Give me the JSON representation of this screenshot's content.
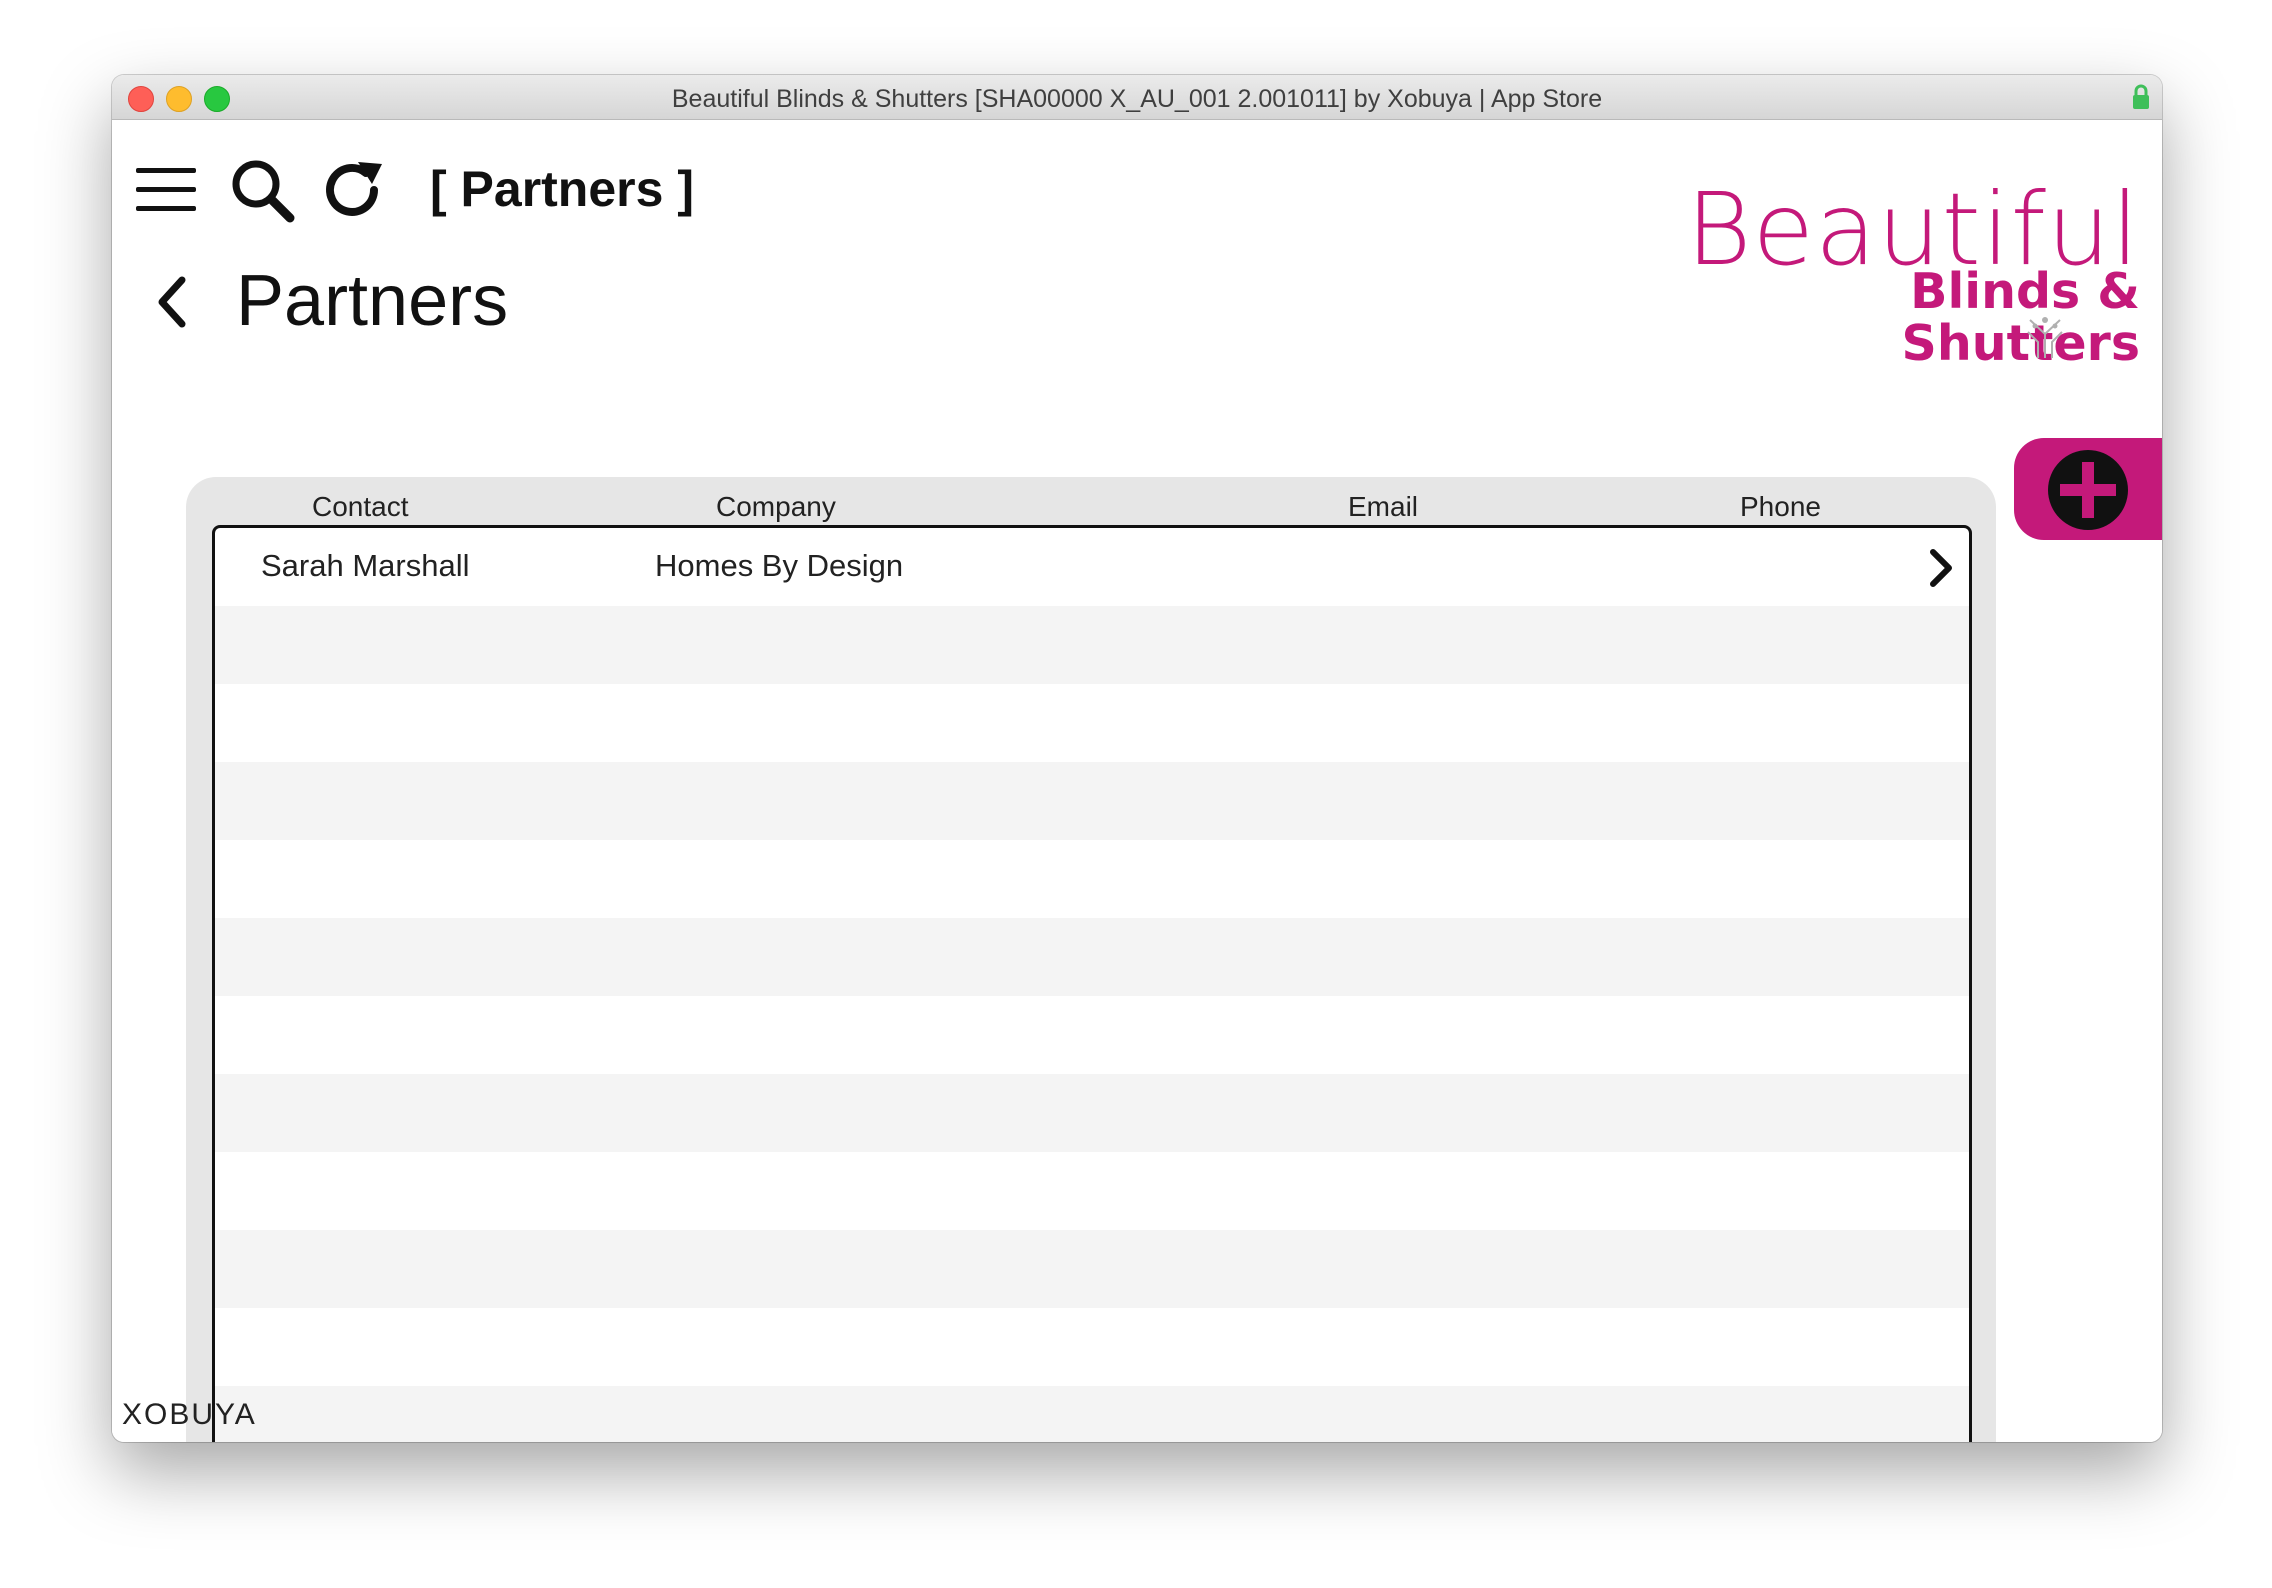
{
  "window": {
    "title": "Beautiful Blinds & Shutters [SHA00000 X_AU_001 2.001011] by Xobuya | App Store"
  },
  "toolbar": {
    "menu_icon": "hamburger-menu-icon",
    "search_icon": "search-icon",
    "refresh_icon": "refresh-icon",
    "section_label": "[ Partners ]"
  },
  "page": {
    "back_icon": "chevron-left-icon",
    "title": "Partners"
  },
  "brand": {
    "line1": "Beautiful",
    "line2": "Blinds & Shutters",
    "color": "#c4197a"
  },
  "add_button": {
    "icon": "plus-circle-icon",
    "color": "#c4197a"
  },
  "table": {
    "columns": [
      "Contact",
      "Company",
      "Email",
      "Phone"
    ],
    "rows": [
      {
        "contact": "Sarah Marshall",
        "company": "Homes By Design",
        "email": "",
        "phone": ""
      }
    ]
  },
  "footer": {
    "logo_text": "XOBUYA"
  }
}
